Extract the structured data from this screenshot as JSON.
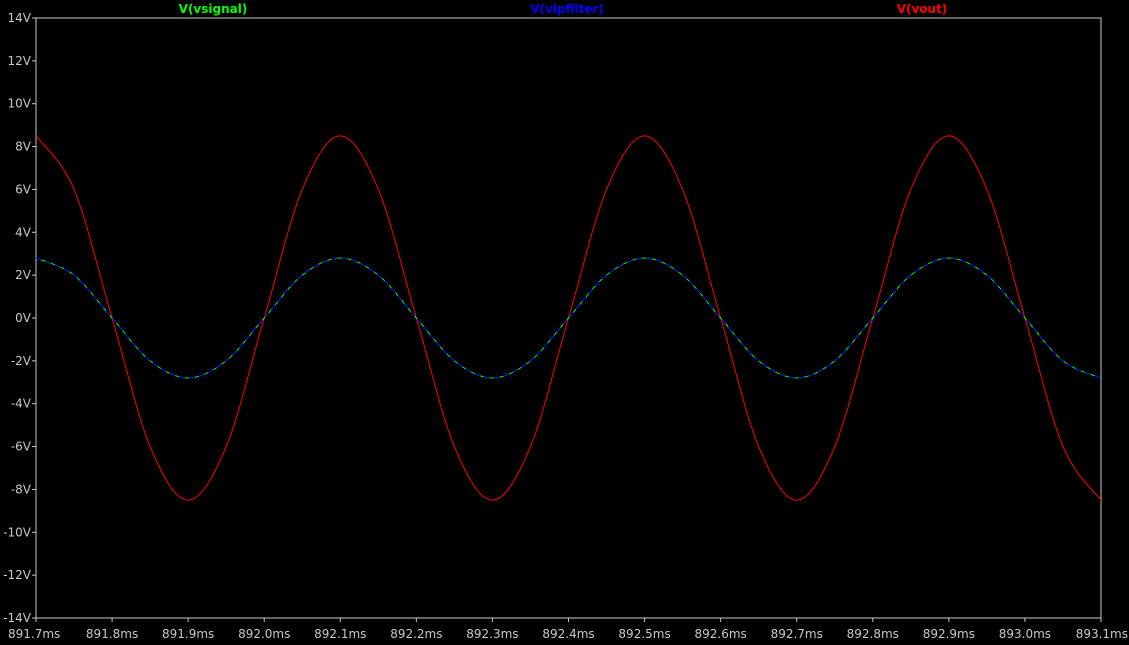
{
  "chart_data": {
    "type": "line",
    "x_unit": "ms",
    "y_unit": "V",
    "xlim": [
      891.7,
      893.1
    ],
    "ylim": [
      -14,
      14
    ],
    "x_ticks": [
      {
        "value": 891.7,
        "label": "891.7ms"
      },
      {
        "value": 891.8,
        "label": "891.8ms"
      },
      {
        "value": 891.9,
        "label": "891.9ms"
      },
      {
        "value": 892.0,
        "label": "892.0ms"
      },
      {
        "value": 892.1,
        "label": "892.1ms"
      },
      {
        "value": 892.2,
        "label": "892.2ms"
      },
      {
        "value": 892.3,
        "label": "892.3ms"
      },
      {
        "value": 892.4,
        "label": "892.4ms"
      },
      {
        "value": 892.5,
        "label": "892.5ms"
      },
      {
        "value": 892.6,
        "label": "892.6ms"
      },
      {
        "value": 892.7,
        "label": "892.7ms"
      },
      {
        "value": 892.8,
        "label": "892.8ms"
      },
      {
        "value": 892.9,
        "label": "892.9ms"
      },
      {
        "value": 893.0,
        "label": "893.0ms"
      },
      {
        "value": 893.1,
        "label": "893.1ms"
      }
    ],
    "y_ticks": [
      {
        "value": 14,
        "label": "14V"
      },
      {
        "value": 12,
        "label": "12V"
      },
      {
        "value": 10,
        "label": "10V"
      },
      {
        "value": 8,
        "label": "8V"
      },
      {
        "value": 6,
        "label": "6V"
      },
      {
        "value": 4,
        "label": "4V"
      },
      {
        "value": 2,
        "label": "2V"
      },
      {
        "value": 0,
        "label": "0V"
      },
      {
        "value": -2,
        "label": "-2V"
      },
      {
        "value": -4,
        "label": "-4V"
      },
      {
        "value": -6,
        "label": "-6V"
      },
      {
        "value": -8,
        "label": "-8V"
      },
      {
        "value": -10,
        "label": "-10V"
      },
      {
        "value": -12,
        "label": "-12V"
      },
      {
        "value": -14,
        "label": "-14V"
      }
    ],
    "grid": false,
    "legend_position": "top",
    "series": [
      {
        "name": "V(vsignal)",
        "color": "#00ff00",
        "x": [
          891.7,
          891.75,
          891.8,
          891.85,
          891.9,
          891.95,
          892.0,
          892.05,
          892.1,
          892.15,
          892.2,
          892.25,
          892.3,
          892.35,
          892.4,
          892.45,
          892.5,
          892.55,
          892.6,
          892.65,
          892.7,
          892.75,
          892.8,
          892.85,
          892.9,
          892.95,
          893.0,
          893.05,
          893.1
        ],
        "y": [
          2.8,
          2.0,
          0.0,
          -2.0,
          -2.8,
          -2.0,
          0.0,
          2.0,
          2.8,
          2.0,
          0.0,
          -2.0,
          -2.8,
          -2.0,
          0.0,
          2.0,
          2.8,
          2.0,
          0.0,
          -2.0,
          -2.8,
          -2.0,
          0.0,
          2.0,
          2.8,
          2.0,
          0.0,
          -2.0,
          -2.8
        ]
      },
      {
        "name": "V(vlpfilter)",
        "color": "#0000ff",
        "x": [
          891.7,
          891.75,
          891.8,
          891.85,
          891.9,
          891.95,
          892.0,
          892.05,
          892.1,
          892.15,
          892.2,
          892.25,
          892.3,
          892.35,
          892.4,
          892.45,
          892.5,
          892.55,
          892.6,
          892.65,
          892.7,
          892.75,
          892.8,
          892.85,
          892.9,
          892.95,
          893.0,
          893.05,
          893.1
        ],
        "y": [
          2.8,
          2.0,
          0.0,
          -2.0,
          -2.8,
          -2.0,
          0.0,
          2.0,
          2.8,
          2.0,
          0.0,
          -2.0,
          -2.8,
          -2.0,
          0.0,
          2.0,
          2.8,
          2.0,
          0.0,
          -2.0,
          -2.8,
          -2.0,
          0.0,
          2.0,
          2.8,
          2.0,
          0.0,
          -2.0,
          -2.8
        ]
      },
      {
        "name": "V(vout)",
        "color": "#ff0000",
        "x": [
          891.7,
          891.75,
          891.8,
          891.85,
          891.9,
          891.95,
          892.0,
          892.05,
          892.1,
          892.15,
          892.2,
          892.25,
          892.3,
          892.35,
          892.4,
          892.45,
          892.5,
          892.55,
          892.6,
          892.65,
          892.7,
          892.75,
          892.8,
          892.85,
          892.9,
          892.95,
          893.0,
          893.05,
          893.1
        ],
        "y": [
          8.5,
          6.0,
          0.0,
          -6.0,
          -8.5,
          -6.0,
          0.0,
          6.0,
          8.5,
          6.0,
          0.0,
          -6.0,
          -8.5,
          -6.0,
          0.0,
          6.0,
          8.5,
          6.0,
          0.0,
          -6.0,
          -8.5,
          -6.0,
          0.0,
          6.0,
          8.5,
          6.0,
          0.0,
          -6.0,
          -8.5
        ]
      }
    ]
  }
}
